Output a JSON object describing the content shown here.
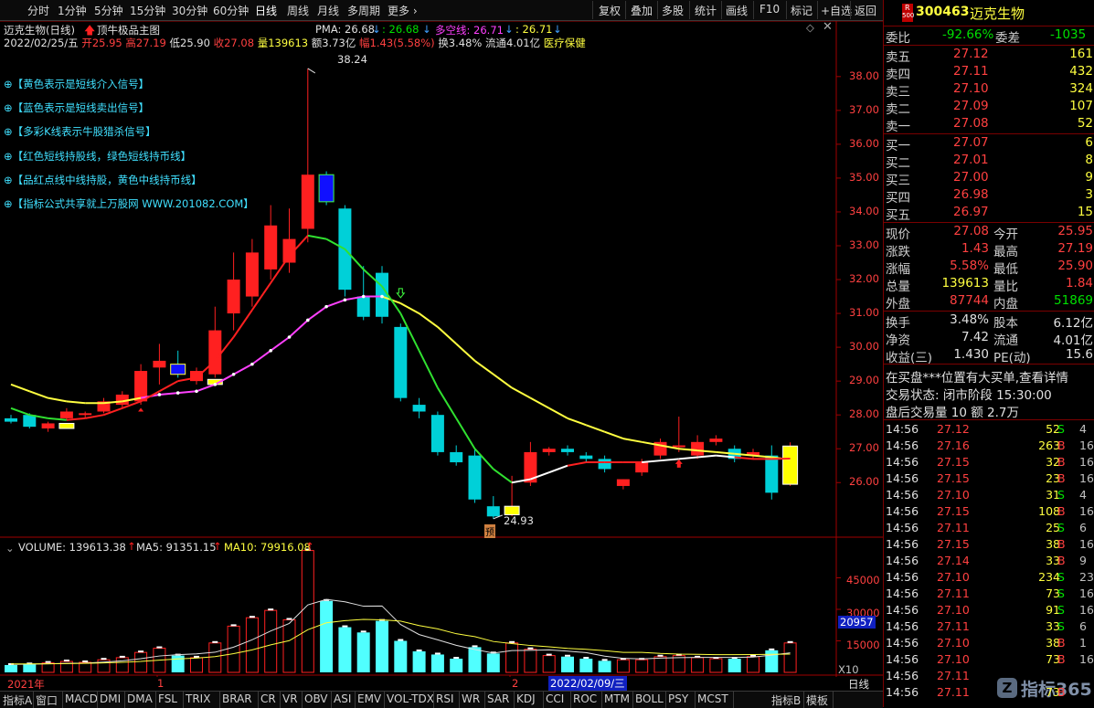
{
  "toolbar": {
    "left_items": [
      "分时",
      "1分钟",
      "5分钟",
      "15分钟",
      "30分钟",
      "60分钟",
      "日线",
      "周线",
      "月线",
      "多周期",
      "更多"
    ],
    "right_items": [
      "复权",
      "叠加",
      "多股",
      "统计",
      "画线",
      "F10",
      "标记",
      "+自选",
      "返回"
    ]
  },
  "header": {
    "title": "迈克生物(日线)",
    "indicator_name": "顶牛极品主图",
    "pma": "PMA: 26.68",
    "val2": ": 26.68",
    "dkx": "多空线: 26.71",
    "val4": ": 26.71",
    "date": "2022/02/25/五",
    "open": "开25.95",
    "high": "高27.19",
    "low": "低25.90",
    "close": "收27.08",
    "vol": "量139613",
    "amount": "额3.73亿",
    "change": "幅1.43(5.58%)",
    "turnover": "换3.48%",
    "float": "流通4.01亿",
    "sector": "医疗保健"
  },
  "signals": [
    "⊕【黄色表示是短线介入信号】",
    "⊕【蓝色表示是短线卖出信号】",
    "⊕【多彩K线表示牛股猎杀信号】",
    "⊕【红色短线持股线，绿色短线持币线】",
    "⊕【品红点线中线持股，黄色中线持币线】",
    "⊕【指标公式共享就上万股网 WWW.201082.COM】"
  ],
  "price_axis": [
    "38.00",
    "37.00",
    "36.00",
    "35.00",
    "34.00",
    "33.00",
    "32.00",
    "31.00",
    "30.00",
    "29.00",
    "28.00",
    "27.00",
    "26.00"
  ],
  "annotations": {
    "high_label": "38.24",
    "low_label": "24.93",
    "pre_label": "预"
  },
  "volume_header": {
    "vol": "VOLUME: 139613.38",
    "ma5": "MA5: 91351.15",
    "ma10": "MA10: 79916.08"
  },
  "volume_axis": {
    "labels": [
      "45000",
      "30000",
      "15000"
    ],
    "current": "20957",
    "unit": "X10"
  },
  "date_axis": {
    "year": "2021年",
    "m1": "1",
    "m2": "2",
    "current": "2022/02/09/三",
    "period": "日线"
  },
  "stock": {
    "code": "300463",
    "name": "迈克生物",
    "tag_r": "R",
    "tag_500": "500"
  },
  "ratio": {
    "wb_label": "委比",
    "wb_value": "-92.66%",
    "wc_label": "委差",
    "wc_value": "-1035"
  },
  "asks": [
    {
      "label": "卖五",
      "price": "27.12",
      "vol": "161"
    },
    {
      "label": "卖四",
      "price": "27.11",
      "vol": "432"
    },
    {
      "label": "卖三",
      "price": "27.10",
      "vol": "324"
    },
    {
      "label": "卖二",
      "price": "27.09",
      "vol": "107"
    },
    {
      "label": "卖一",
      "price": "27.08",
      "vol": "52"
    }
  ],
  "bids": [
    {
      "label": "买一",
      "price": "27.07",
      "vol": "6"
    },
    {
      "label": "买二",
      "price": "27.01",
      "vol": "8"
    },
    {
      "label": "买三",
      "price": "27.00",
      "vol": "9"
    },
    {
      "label": "买四",
      "price": "26.98",
      "vol": "3"
    },
    {
      "label": "买五",
      "price": "26.97",
      "vol": "15"
    }
  ],
  "quote": [
    {
      "l1": "现价",
      "v1": "27.08",
      "l2": "今开",
      "v2": "25.95"
    },
    {
      "l1": "涨跌",
      "v1": "1.43",
      "l2": "最高",
      "v2": "27.19"
    },
    {
      "l1": "涨幅",
      "v1": "5.58%",
      "l2": "最低",
      "v2": "25.90"
    },
    {
      "l1": "总量",
      "v1": "139613",
      "l2": "量比",
      "v2": "1.84"
    },
    {
      "l1": "外盘",
      "v1": "87744",
      "l2": "内盘",
      "v2": "51869"
    }
  ],
  "fund": [
    {
      "l1": "换手",
      "v1": "3.48%",
      "l2": "股本",
      "v2": "6.12亿"
    },
    {
      "l1": "净资",
      "v1": "7.42",
      "l2": "流通",
      "v2": "4.01亿"
    },
    {
      "l1": "收益(三)",
      "v1": "1.430",
      "l2": "PE(动)",
      "v2": "15.6"
    }
  ],
  "notice": "在买盘***位置有大买单,查看详情",
  "status": "交易状态: 闭市阶段 15:30:00",
  "after_hours": "盘后交易量 10 额 2.7万",
  "ticks": [
    {
      "t": "14:56",
      "p": "27.12",
      "v": "52",
      "s": "S",
      "x": "4"
    },
    {
      "t": "14:56",
      "p": "27.16",
      "v": "263",
      "s": "B",
      "x": "16"
    },
    {
      "t": "14:56",
      "p": "27.15",
      "v": "32",
      "s": "B",
      "x": "16"
    },
    {
      "t": "14:56",
      "p": "27.15",
      "v": "23",
      "s": "B",
      "x": "16"
    },
    {
      "t": "14:56",
      "p": "27.10",
      "v": "31",
      "s": "S",
      "x": "4"
    },
    {
      "t": "14:56",
      "p": "27.15",
      "v": "108",
      "s": "B",
      "x": "16"
    },
    {
      "t": "14:56",
      "p": "27.11",
      "v": "25",
      "s": "S",
      "x": "6"
    },
    {
      "t": "14:56",
      "p": "27.15",
      "v": "38",
      "s": "B",
      "x": "16"
    },
    {
      "t": "14:56",
      "p": "27.14",
      "v": "33",
      "s": "B",
      "x": "9"
    },
    {
      "t": "14:56",
      "p": "27.10",
      "v": "234",
      "s": "S",
      "x": "23"
    },
    {
      "t": "14:56",
      "p": "27.11",
      "v": "73",
      "s": "S",
      "x": "16"
    },
    {
      "t": "14:56",
      "p": "27.10",
      "v": "91",
      "s": "S",
      "x": "16"
    },
    {
      "t": "14:56",
      "p": "27.11",
      "v": "33",
      "s": "S",
      "x": "6"
    },
    {
      "t": "14:56",
      "p": "27.10",
      "v": "38",
      "s": "B",
      "x": "1"
    },
    {
      "t": "14:56",
      "p": "27.10",
      "v": "73",
      "s": "B",
      "x": "16"
    },
    {
      "t": "14:56",
      "p": "27.11",
      "v": "",
      "s": "",
      "x": ""
    },
    {
      "t": "14:56",
      "p": "27.11",
      "v": "73",
      "s": "B",
      "x": ""
    }
  ],
  "bottom_tabs": [
    "指标A",
    "窗口",
    "MACD",
    "DMI",
    "DMA",
    "FSL",
    "TRIX",
    "BRAR",
    "CR",
    "VR",
    "OBV",
    "ASI",
    "EMV",
    "VOL-TDX",
    "RSI",
    "WR",
    "SAR",
    "KDJ",
    "CCI",
    "ROC",
    "MTM",
    "BOLL",
    "PSY",
    "MCST",
    "指标B",
    "模板"
  ],
  "watermark": "指标365",
  "chart_data": {
    "type": "candlestick",
    "candles": [
      {
        "o": 27.9,
        "h": 28.0,
        "l": 27.75,
        "c": 27.8
      },
      {
        "o": 28.0,
        "h": 28.05,
        "l": 27.6,
        "c": 27.65
      },
      {
        "o": 27.6,
        "h": 27.8,
        "l": 27.5,
        "c": 27.75
      },
      {
        "o": 27.9,
        "h": 28.2,
        "l": 27.85,
        "c": 28.1
      },
      {
        "o": 28.0,
        "h": 28.1,
        "l": 27.9,
        "c": 28.05
      },
      {
        "o": 28.1,
        "h": 28.5,
        "l": 28.05,
        "c": 28.4
      },
      {
        "o": 28.3,
        "h": 28.7,
        "l": 28.2,
        "c": 28.6
      },
      {
        "o": 28.4,
        "h": 29.5,
        "l": 28.3,
        "c": 29.3
      },
      {
        "o": 29.4,
        "h": 30.1,
        "l": 28.9,
        "c": 29.6
      },
      {
        "o": 29.5,
        "h": 29.9,
        "l": 29.1,
        "c": 29.2
      },
      {
        "o": 29.0,
        "h": 29.4,
        "l": 28.9,
        "c": 29.3
      },
      {
        "o": 29.2,
        "h": 31.2,
        "l": 29.1,
        "c": 30.5
      },
      {
        "o": 31.0,
        "h": 32.8,
        "l": 30.5,
        "c": 32.0
      },
      {
        "o": 31.5,
        "h": 33.2,
        "l": 31.2,
        "c": 32.8
      },
      {
        "o": 32.3,
        "h": 34.2,
        "l": 32.0,
        "c": 33.6
      },
      {
        "o": 32.5,
        "h": 34.1,
        "l": 32.2,
        "c": 33.2
      },
      {
        "o": 33.5,
        "h": 38.24,
        "l": 33.1,
        "c": 35.1
      },
      {
        "o": 35.1,
        "h": 35.2,
        "l": 34.2,
        "c": 34.3
      },
      {
        "o": 34.1,
        "h": 34.2,
        "l": 31.5,
        "c": 31.7
      },
      {
        "o": 31.5,
        "h": 32.4,
        "l": 30.8,
        "c": 30.9
      },
      {
        "o": 32.2,
        "h": 32.4,
        "l": 30.7,
        "c": 30.9
      },
      {
        "o": 30.6,
        "h": 30.7,
        "l": 28.4,
        "c": 28.5
      },
      {
        "o": 28.3,
        "h": 28.5,
        "l": 27.9,
        "c": 28.1
      },
      {
        "o": 28.0,
        "h": 28.1,
        "l": 26.8,
        "c": 26.9
      },
      {
        "o": 26.9,
        "h": 27.1,
        "l": 26.5,
        "c": 26.6
      },
      {
        "o": 26.8,
        "h": 27.0,
        "l": 25.4,
        "c": 25.5
      },
      {
        "o": 25.3,
        "h": 25.6,
        "l": 24.93,
        "c": 25.0
      },
      {
        "o": 25.1,
        "h": 26.2,
        "l": 25.0,
        "c": 25.3
      },
      {
        "o": 26.0,
        "h": 27.2,
        "l": 25.9,
        "c": 26.9
      },
      {
        "o": 26.9,
        "h": 27.05,
        "l": 26.8,
        "c": 27.0
      },
      {
        "o": 27.0,
        "h": 27.1,
        "l": 26.8,
        "c": 26.9
      },
      {
        "o": 26.8,
        "h": 26.9,
        "l": 26.6,
        "c": 26.7
      },
      {
        "o": 26.7,
        "h": 26.8,
        "l": 26.3,
        "c": 26.4
      },
      {
        "o": 25.9,
        "h": 26.1,
        "l": 25.8,
        "c": 26.1
      },
      {
        "o": 26.3,
        "h": 26.7,
        "l": 26.2,
        "c": 26.6
      },
      {
        "o": 26.8,
        "h": 27.3,
        "l": 26.7,
        "c": 27.2
      },
      {
        "o": 27.05,
        "h": 27.95,
        "l": 26.9,
        "c": 27.1
      },
      {
        "o": 26.8,
        "h": 27.4,
        "l": 26.7,
        "c": 27.2
      },
      {
        "o": 27.2,
        "h": 27.4,
        "l": 27.1,
        "c": 27.3
      },
      {
        "o": 27.0,
        "h": 27.1,
        "l": 26.6,
        "c": 26.7
      },
      {
        "o": 26.8,
        "h": 27.0,
        "l": 26.7,
        "c": 26.9
      },
      {
        "o": 26.8,
        "h": 27.1,
        "l": 25.5,
        "c": 25.7
      },
      {
        "o": 25.95,
        "h": 27.19,
        "l": 25.9,
        "c": 27.08
      }
    ],
    "short_line": [
      28.2,
      28.0,
      27.9,
      27.85,
      27.9,
      28.0,
      28.2,
      28.4,
      28.7,
      29.0,
      29.1,
      29.6,
      30.3,
      31.1,
      31.9,
      32.7,
      33.3,
      33.2,
      32.9,
      32.3,
      31.8,
      31.0,
      29.9,
      28.8,
      27.9,
      27.0,
      26.4,
      26.0,
      26.1,
      26.3,
      26.5,
      26.6,
      26.6,
      26.6,
      26.6,
      26.65,
      26.7,
      26.75,
      26.8,
      26.75,
      26.7,
      26.7,
      26.71
    ],
    "mid_line": [
      28.9,
      28.7,
      28.5,
      28.4,
      28.35,
      28.35,
      28.4,
      28.5,
      28.6,
      28.65,
      28.7,
      28.9,
      29.2,
      29.5,
      29.9,
      30.3,
      30.8,
      31.2,
      31.4,
      31.5,
      31.5,
      31.3,
      31.0,
      30.6,
      30.1,
      29.6,
      29.2,
      28.8,
      28.5,
      28.2,
      27.9,
      27.7,
      27.5,
      27.3,
      27.2,
      27.1,
      27.0,
      26.95,
      26.9,
      26.85,
      26.8,
      26.75,
      26.68
    ],
    "ylim": [
      24.9,
      38.4
    ],
    "volume": [
      3500,
      3800,
      4500,
      5200,
      4800,
      6000,
      7000,
      9500,
      11500,
      8000,
      7000,
      14000,
      22000,
      26000,
      29500,
      25000,
      58000,
      34000,
      21500,
      19000,
      24500,
      15000,
      10000,
      8500,
      6500,
      12000,
      9000,
      14000,
      11000,
      8000,
      7500,
      6500,
      5500,
      6000,
      6000,
      7500,
      8000,
      7000,
      6500,
      6500,
      7500,
      10500,
      14000
    ],
    "vol_ma5": [
      3800,
      3900,
      4100,
      4300,
      4400,
      4900,
      5500,
      6500,
      7800,
      8400,
      8800,
      9600,
      12000,
      15500,
      19700,
      23300,
      32100,
      34700,
      33600,
      31500,
      31600,
      22800,
      18000,
      15500,
      12900,
      10900,
      9200,
      10400,
      10500,
      10700,
      10100,
      9400,
      7700,
      6700,
      6400,
      6800,
      7000,
      7100,
      7100,
      7100,
      7300,
      8200,
      9300
    ],
    "vol_ma10": [
      4000,
      4000,
      4100,
      4200,
      4300,
      4500,
      4800,
      5200,
      5800,
      6400,
      6800,
      7500,
      8900,
      10700,
      13100,
      15100,
      20300,
      23600,
      24600,
      25200,
      25000,
      24400,
      22300,
      20700,
      18400,
      17000,
      14700,
      13700,
      12800,
      12200,
      11400,
      11000,
      10300,
      9500,
      9500,
      9000,
      8700,
      8600,
      8400,
      8400,
      8500,
      8600,
      8700
    ],
    "vol_ylim": [
      0,
      60000
    ]
  }
}
